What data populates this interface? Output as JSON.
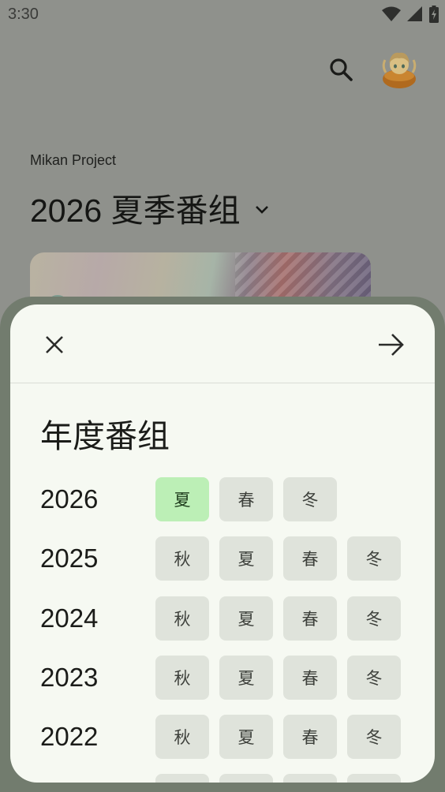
{
  "status_bar": {
    "time": "3:30"
  },
  "header": {
    "subtitle": "Mikan Project",
    "title": "2026 夏季番组",
    "icons": [
      "search-icon",
      "avatar",
      "chevron-down-icon"
    ]
  },
  "dialog": {
    "title": "年度番组",
    "close_icon": "close-icon",
    "next_icon": "arrow-right-icon",
    "years": [
      {
        "year": "2026",
        "seasons": [
          "夏",
          "春",
          "冬"
        ],
        "selected": "夏"
      },
      {
        "year": "2025",
        "seasons": [
          "秋",
          "夏",
          "春",
          "冬"
        ]
      },
      {
        "year": "2024",
        "seasons": [
          "秋",
          "夏",
          "春",
          "冬"
        ]
      },
      {
        "year": "2023",
        "seasons": [
          "秋",
          "夏",
          "春",
          "冬"
        ]
      },
      {
        "year": "2022",
        "seasons": [
          "秋",
          "夏",
          "春",
          "冬"
        ]
      }
    ]
  },
  "colors": {
    "selected_chip": "#bcefb6",
    "chip": "#dfe3db",
    "dialog_bg": "#f6f9f2",
    "scrim": "#8f918c"
  }
}
